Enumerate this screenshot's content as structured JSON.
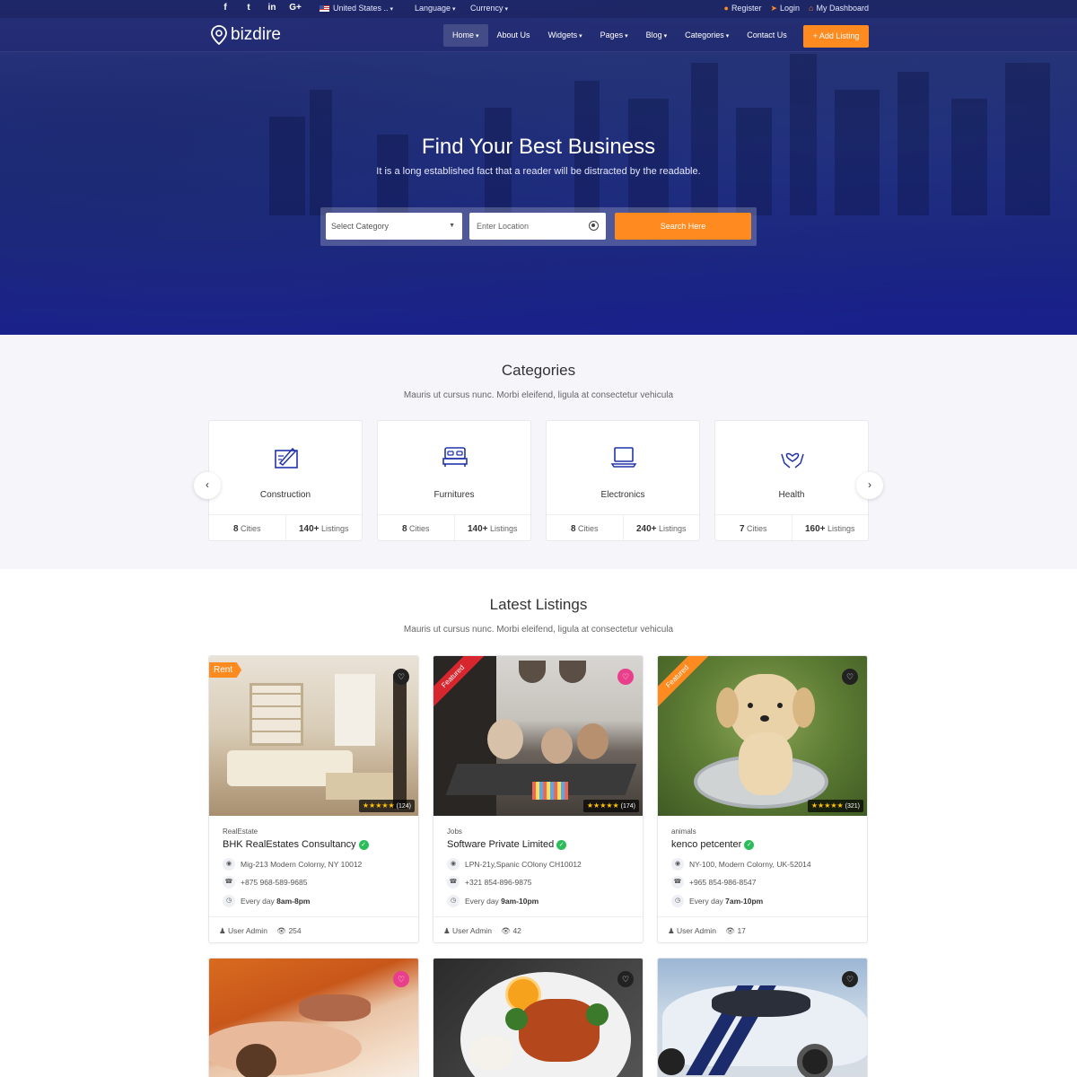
{
  "topbar": {
    "social": [
      "f",
      "t",
      "in",
      "G+"
    ],
    "country": "United States",
    "language": "Language",
    "currency": "Currency",
    "register": "Register",
    "login": "Login",
    "dashboard": "My Dashboard"
  },
  "nav": {
    "logo": "bizdire",
    "items": [
      "Home",
      "About Us",
      "Widgets",
      "Pages",
      "Blog",
      "Categories",
      "Contact Us"
    ],
    "add_listing": "+ Add Listing"
  },
  "hero": {
    "title": "Find Your Best Business",
    "subtitle": "It is a long established fact that a reader will be distracted by the readable.",
    "category_placeholder": "Select Category",
    "location_placeholder": "Enter Location",
    "search_label": "Search Here"
  },
  "categories": {
    "title": "Categories",
    "subtitle": "Mauris ut cursus nunc. Morbi eleifend, ligula at consectetur vehicula",
    "items": [
      {
        "name": "Construction",
        "cities": "8",
        "cities_label": "Cities",
        "listings": "140+",
        "listings_label": "Listings",
        "icon": "construction-icon"
      },
      {
        "name": "Furnitures",
        "cities": "8",
        "cities_label": "Cities",
        "listings": "140+",
        "listings_label": "Listings",
        "icon": "bed-icon"
      },
      {
        "name": "Electronics",
        "cities": "8",
        "cities_label": "Cities",
        "listings": "240+",
        "listings_label": "Listings",
        "icon": "laptop-icon"
      },
      {
        "name": "Health",
        "cities": "7",
        "cities_label": "Cities",
        "listings": "160+",
        "listings_label": "Listings",
        "icon": "heart-hands-icon"
      }
    ]
  },
  "listings": {
    "title": "Latest Listings",
    "subtitle": "Mauris ut cursus nunc. Morbi eleifend, ligula at consectetur vehicula",
    "items": [
      {
        "badge": "Rent",
        "category": "RealEstate",
        "title": "BHK RealEstates Consultancy",
        "address": "Mig-213 Modern Colorny, NY 10012",
        "phone": "+875 968-589-9685",
        "hours_prefix": "Every day",
        "hours": "8am-8pm",
        "user": "User Admin",
        "views": "254",
        "reviews": "(124)",
        "stars": "★★★★★"
      },
      {
        "badge": "Featured",
        "category": "Jobs",
        "title": "Software Private Limited",
        "address": "LPN-21y,Spanic COlony CH10012",
        "phone": "+321 854-896-9875",
        "hours_prefix": "Every day",
        "hours": "9am-10pm",
        "user": "User Admin",
        "views": "42",
        "reviews": "(174)",
        "stars": "★★★★★"
      },
      {
        "badge": "Featured",
        "category": "animals",
        "title": "kenco petcenter",
        "address": "NY-100, Modern Colorny, UK-52014",
        "phone": "+965 854-986-8547",
        "hours_prefix": "Every day",
        "hours": "7am-10pm",
        "user": "User Admin",
        "views": "17",
        "reviews": "(321)",
        "stars": "★★★★★"
      }
    ]
  },
  "colors": {
    "accent": "#ff8a1f",
    "primary": "#1e2a9a",
    "verified": "#2bbd5a",
    "heart_pink": "#e83e8c"
  }
}
